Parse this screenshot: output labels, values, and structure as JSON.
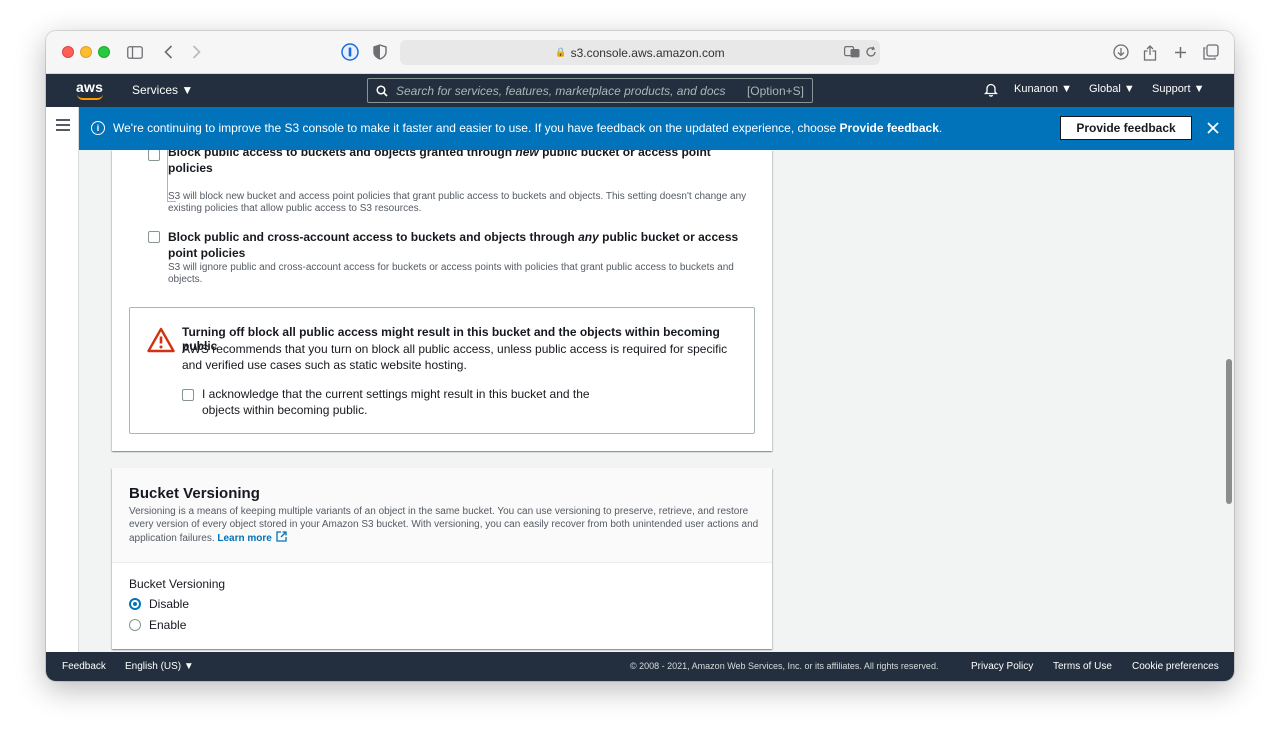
{
  "browser": {
    "url": "s3.console.aws.amazon.com"
  },
  "header": {
    "logo": "aws",
    "services": "Services ▼",
    "search_placeholder": "Search for services, features, marketplace products, and docs",
    "search_shortcut": "[Option+S]",
    "user": "Kunanon ▼",
    "region": "Global ▼",
    "support": "Support ▼"
  },
  "flash": {
    "message_prefix": "We're continuing to improve the S3 console to make it faster and easier to use. If you have feedback on the updated experience, choose ",
    "message_bold": "Provide feedback",
    "message_suffix": ".",
    "button": "Provide feedback"
  },
  "block_access": {
    "option_new": {
      "title_prefix": "Block public access to buckets and objects granted through ",
      "title_em": "new",
      "title_suffix": " public bucket or access point policies",
      "desc": "S3 will block new bucket and access point policies that grant public access to buckets and objects. This setting doesn't change any existing policies that allow public access to S3 resources."
    },
    "option_any": {
      "title_prefix": "Block public and cross-account access to buckets and objects through ",
      "title_em": "any",
      "title_suffix": " public bucket or access point policies",
      "desc": "S3 will ignore public and cross-account access for buckets or access points with policies that grant public access to buckets and objects."
    },
    "warning": {
      "title": "Turning off block all public access might result in this bucket and the objects within becoming public",
      "text": "AWS recommends that you turn on block all public access, unless public access is required for specific and verified use cases such as static website hosting.",
      "acknowledge": "I acknowledge that the current settings might result in this bucket and the objects within becoming public."
    }
  },
  "versioning": {
    "title": "Bucket Versioning",
    "desc": "Versioning is a means of keeping multiple variants of an object in the same bucket. You can use versioning to preserve, retrieve, and restore every version of every object stored in your Amazon S3 bucket. With versioning, you can easily recover from both unintended user actions and application failures.",
    "learn_more": "Learn more",
    "label": "Bucket Versioning",
    "options": [
      "Disable",
      "Enable"
    ],
    "selected": "Disable"
  },
  "footer": {
    "feedback": "Feedback",
    "language": "English (US) ▼",
    "copyright": "© 2008 - 2021, Amazon Web Services, Inc. or its affiliates. All rights reserved.",
    "privacy": "Privacy Policy",
    "terms": "Terms of Use",
    "cookies": "Cookie preferences"
  }
}
